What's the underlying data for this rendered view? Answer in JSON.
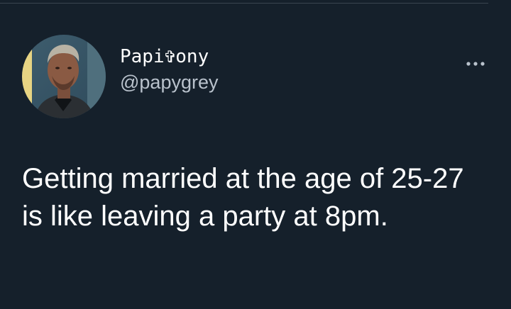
{
  "tweet": {
    "author": {
      "display_name": "Papi✞ony",
      "handle": "@papygrey",
      "avatar_icon": "user-avatar-photo"
    },
    "menu_icon": "more-options-icon",
    "text": "Getting married at the age of 25-27 is like leaving a party at 8pm."
  },
  "colors": {
    "background": "#15202b",
    "primary_text": "#ffffff",
    "secondary_text": "#b9c2cc"
  }
}
